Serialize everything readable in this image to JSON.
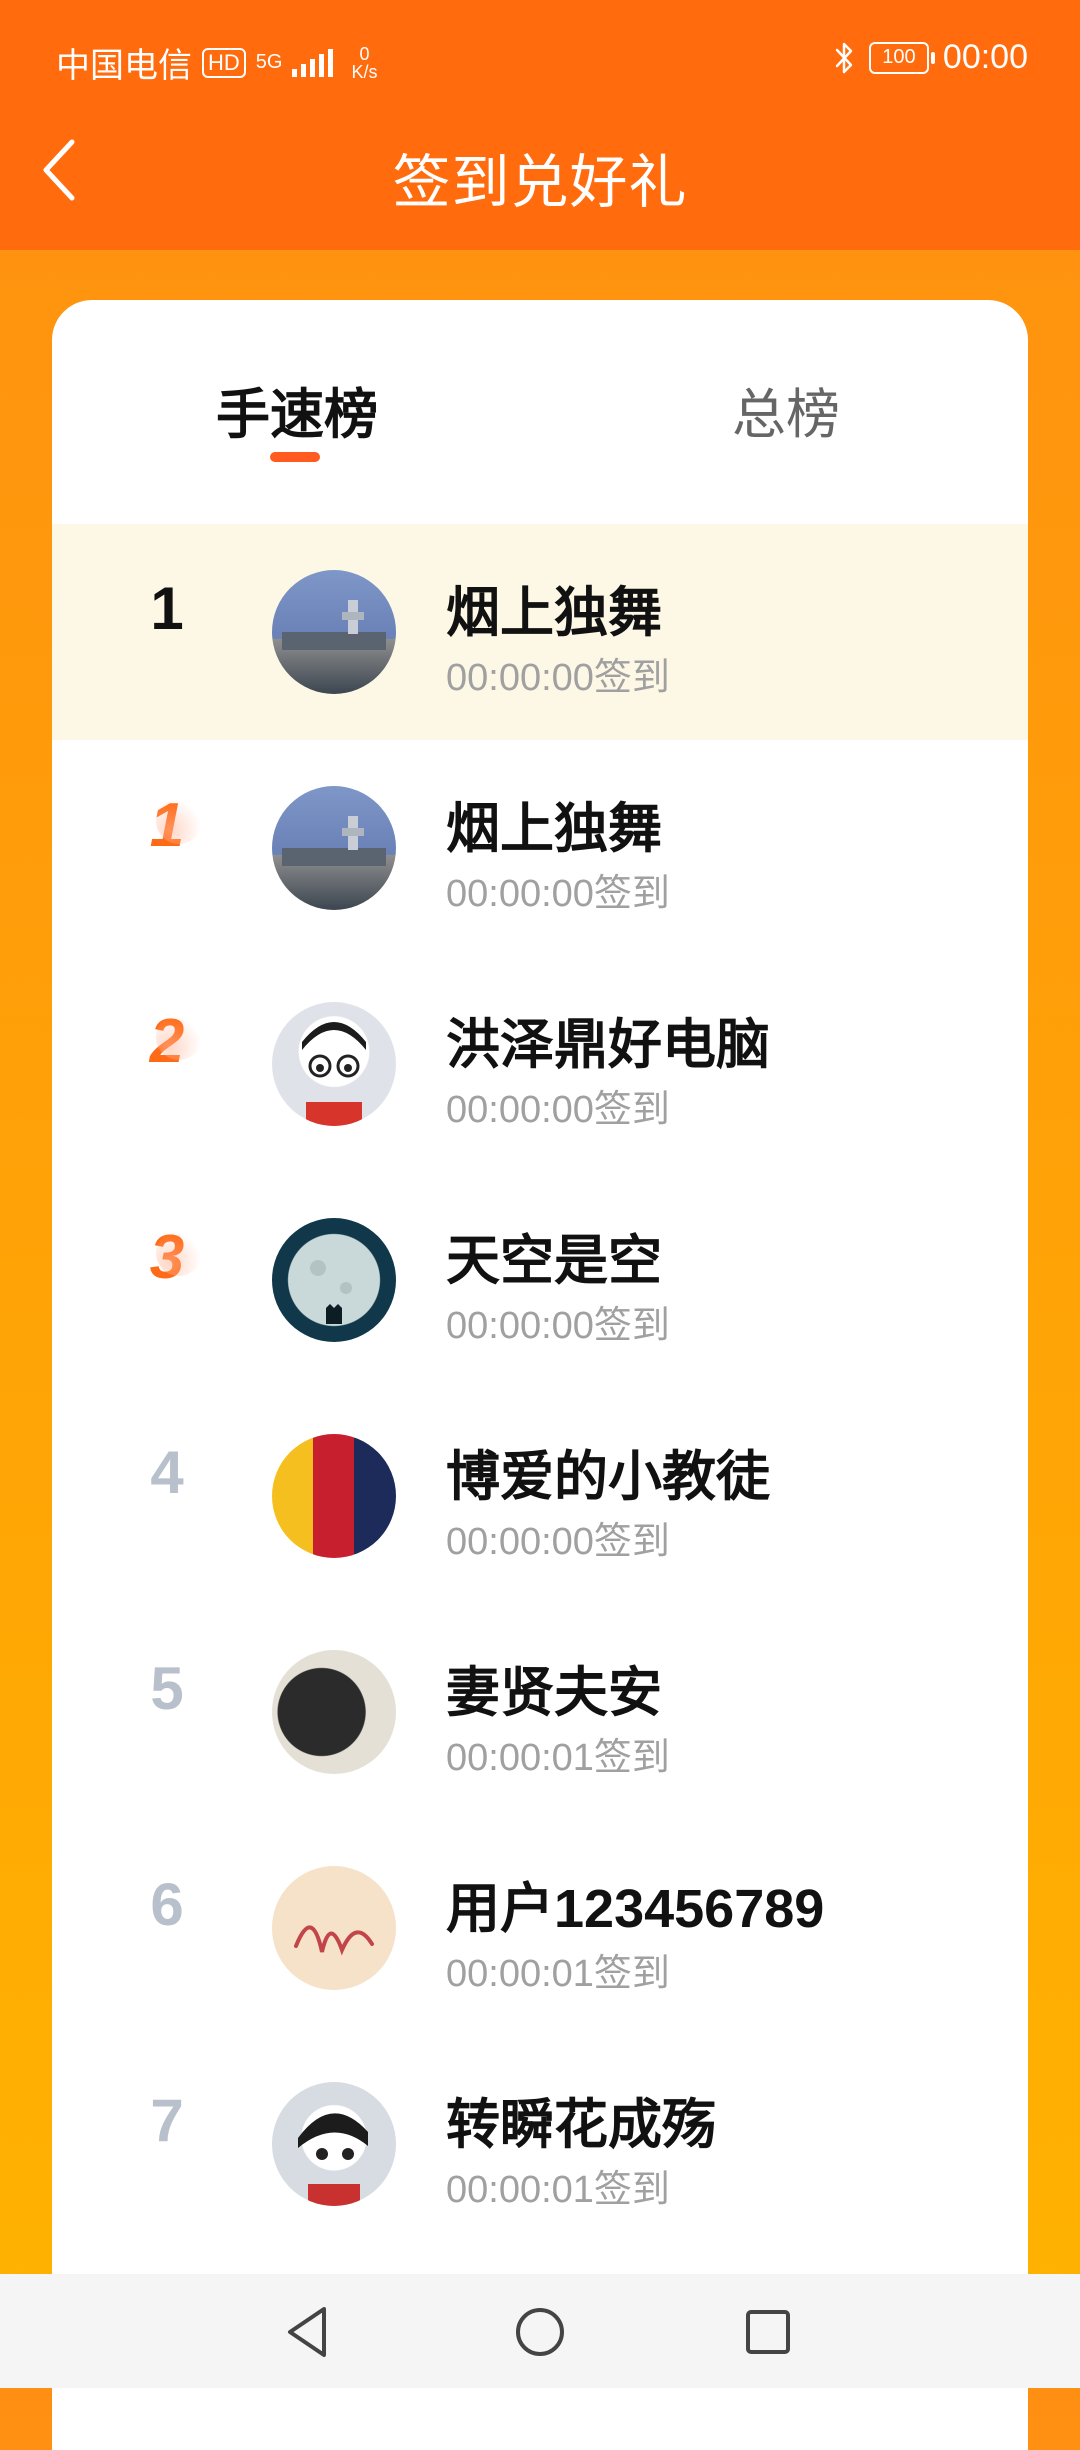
{
  "status": {
    "carrier": "中国电信",
    "hd": "HD",
    "net_type": "5G",
    "speed_value": "0",
    "speed_unit": "K/s",
    "battery": "100",
    "time": "00:00"
  },
  "header": {
    "title": "签到兑好礼"
  },
  "tabs": [
    {
      "label": "手速榜"
    },
    {
      "label": "总榜"
    }
  ],
  "rows": [
    {
      "rank": "1",
      "name": "烟上独舞",
      "time": "00:00:00签到"
    },
    {
      "rank": "1",
      "name": "烟上独舞",
      "time": "00:00:00签到"
    },
    {
      "rank": "2",
      "name": "洪泽鼎好电脑",
      "time": "00:00:00签到"
    },
    {
      "rank": "3",
      "name": "天空是空",
      "time": "00:00:00签到"
    },
    {
      "rank": "4",
      "name": "博爱的小教徒",
      "time": "00:00:00签到"
    },
    {
      "rank": "5",
      "name": "妻贤夫安",
      "time": "00:00:01签到"
    },
    {
      "rank": "6",
      "name": "用户123456789",
      "time": "00:00:01签到"
    },
    {
      "rank": "7",
      "name": "转瞬花成殇",
      "time": "00:00:01签到"
    }
  ],
  "icons": {
    "back": "chevron-left-icon",
    "bluetooth": "bluetooth-icon",
    "nav_back": "triangle-back-icon",
    "nav_home": "circle-home-icon",
    "nav_recent": "square-recent-icon"
  },
  "colors": {
    "header": "#ff6b0d",
    "accent": "#ff5a1f",
    "top_rank": "#ff6a16",
    "normal_rank": "#b8c0cc",
    "highlight_row": "#fdf8e6"
  }
}
